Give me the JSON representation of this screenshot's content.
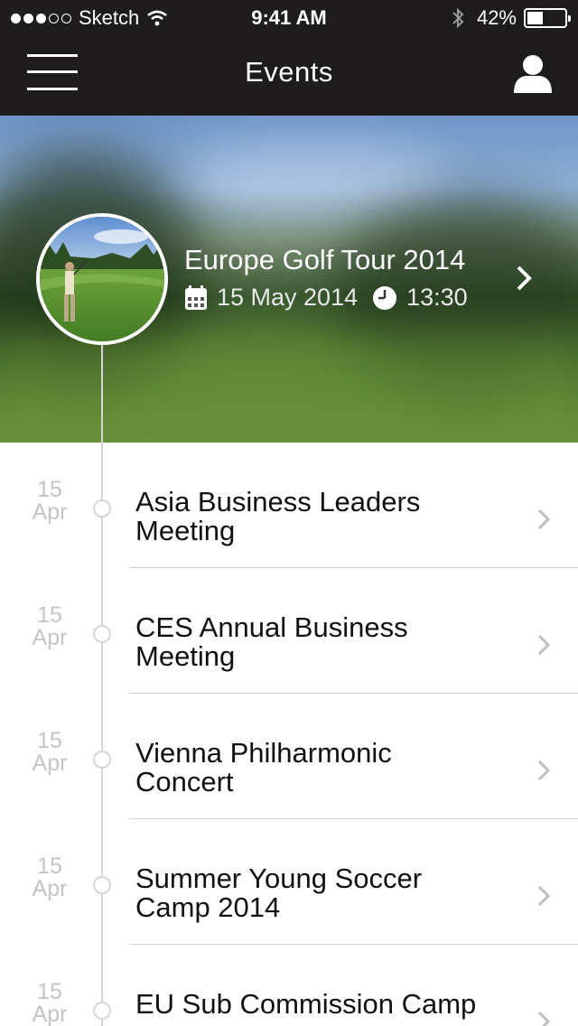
{
  "status_bar": {
    "carrier": "Sketch",
    "time": "9:41 AM",
    "battery": "42%",
    "battery_level": 0.42,
    "signal_full": 3,
    "signal_total": 5
  },
  "nav": {
    "title": "Events",
    "menu_icon": "hamburger-icon",
    "profile_icon": "user-icon"
  },
  "featured": {
    "title": "Europe Golf Tour 2014",
    "date": "15 May 2014",
    "time": "13:30"
  },
  "events": [
    {
      "day": "15",
      "month": "Apr",
      "title": "Asia Business Leaders Meeting"
    },
    {
      "day": "15",
      "month": "Apr",
      "title": "CES Annual Business Meeting"
    },
    {
      "day": "15",
      "month": "Apr",
      "title": "Vienna Philharmonic Concert"
    },
    {
      "day": "15",
      "month": "Apr",
      "title": "Summer Young Soccer Camp 2014"
    },
    {
      "day": "15",
      "month": "Apr",
      "title": "EU Sub Commission Camp"
    }
  ],
  "colors": {
    "nav_background": "#1e1c1c",
    "timeline": "#d6d6d6",
    "date_text": "#c4c4c4"
  }
}
